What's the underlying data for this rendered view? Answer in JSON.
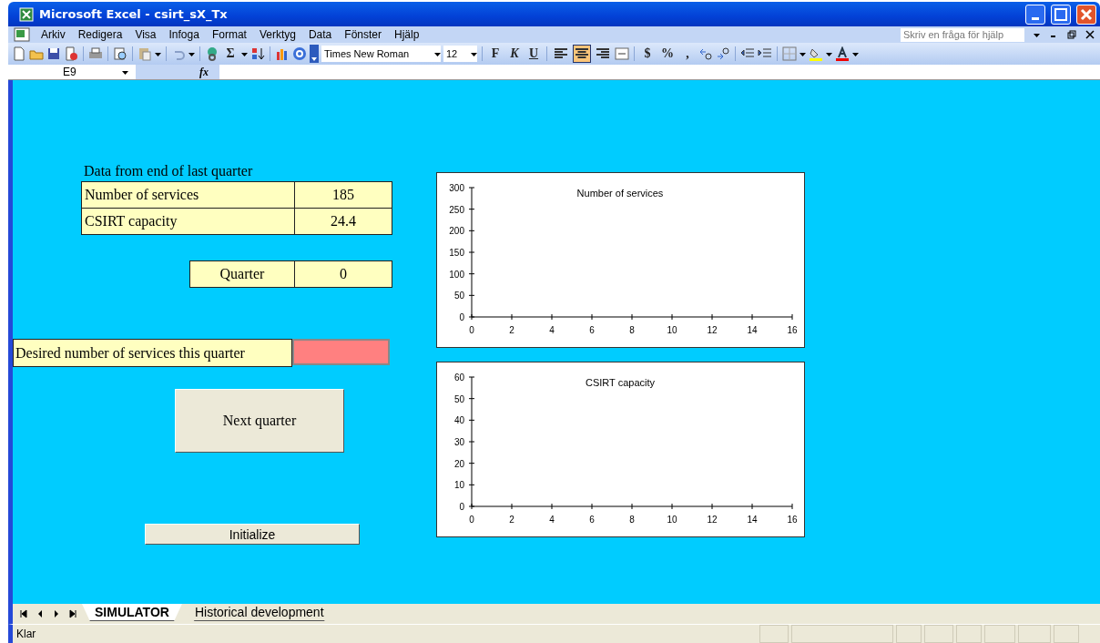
{
  "window": {
    "title": "Microsoft Excel - csirt_sX_Tx"
  },
  "menu": [
    "Arkiv",
    "Redigera",
    "Visa",
    "Infoga",
    "Format",
    "Verktyg",
    "Data",
    "Fönster",
    "Hjälp"
  ],
  "help_search": {
    "placeholder": "Skriv en fråga för hjälp"
  },
  "toolbar": {
    "sum": "Σ",
    "font": "Times New Roman",
    "size": "12",
    "bold": "F",
    "italic": "K",
    "underline": "U",
    "currency": "$",
    "percent": "%",
    "comma": ",",
    "alignment": [
      {
        "selected": false
      },
      {
        "selected": true
      },
      {
        "selected": false
      }
    ]
  },
  "formula_bar": {
    "name_box": "E9",
    "fx": "fx"
  },
  "sheet": {
    "heading": "Data from end of last quarter",
    "stats": [
      {
        "label": "Number of services",
        "value": "185"
      },
      {
        "label": "CSIRT capacity",
        "value": "24.4"
      }
    ],
    "quarter": {
      "label": "Quarter",
      "value": "0"
    },
    "desired": {
      "label": "Desired number of services this quarter"
    },
    "next_button": "Next quarter",
    "init_button": "Initialize",
    "charts": [
      {
        "chart_data": {
          "type": "line",
          "title": "Number of services",
          "xlim": [
            0,
            16
          ],
          "ylim": [
            0,
            300
          ],
          "xticks": [
            0,
            2,
            4,
            6,
            8,
            10,
            12,
            14,
            16
          ],
          "yticks": [
            0,
            50,
            100,
            150,
            200,
            250,
            300
          ]
        }
      },
      {
        "chart_data": {
          "type": "line",
          "title": "CSIRT capacity",
          "xlim": [
            0,
            16
          ],
          "ylim": [
            0,
            60
          ],
          "xticks": [
            0,
            2,
            4,
            6,
            8,
            10,
            12,
            14,
            16
          ],
          "yticks": [
            0,
            10,
            20,
            30,
            40,
            50,
            60
          ]
        }
      }
    ]
  },
  "sheet_tabs": [
    {
      "label": "SIMULATOR",
      "selected": true
    },
    {
      "label": "Historical development",
      "selected": false
    }
  ],
  "status_bar": {
    "text": "Klar"
  }
}
